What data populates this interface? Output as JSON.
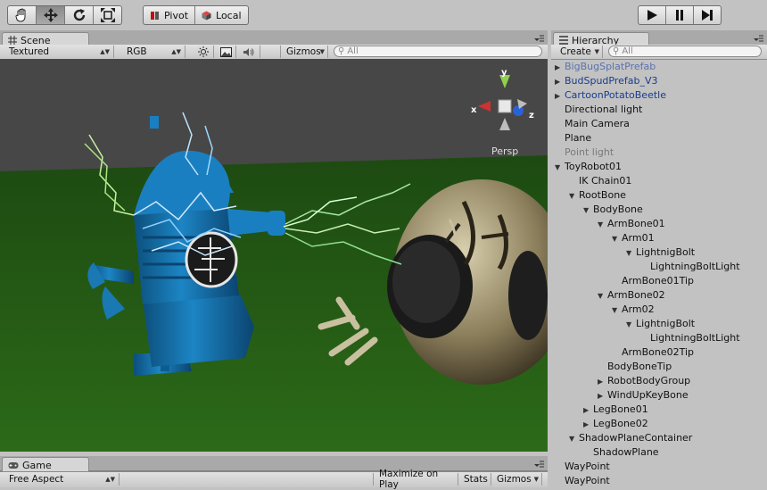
{
  "toolbar": {
    "tools": [
      {
        "icon": "hand-icon"
      },
      {
        "icon": "move-icon"
      },
      {
        "icon": "rotate-icon"
      },
      {
        "icon": "scale-icon"
      }
    ],
    "pivot_label": "Pivot",
    "local_label": "Local",
    "play_controls": [
      {
        "icon": "play-icon"
      },
      {
        "icon": "pause-icon"
      },
      {
        "icon": "step-icon"
      }
    ]
  },
  "scene": {
    "tab_label": "Scene",
    "render_mode": "Textured",
    "color_mode": "RGB",
    "gizmos_label": "Gizmos",
    "search_placeholder": "All",
    "projection_label": "Persp",
    "axis_x": "x",
    "axis_y": "y",
    "axis_z": "z"
  },
  "hierarchy": {
    "tab_label": "Hierarchy",
    "create_label": "Create",
    "search_placeholder": "All",
    "items": [
      {
        "label": "BigBugSplatPrefab",
        "depth": 0,
        "arrow": "collapsed",
        "style": "lightblue"
      },
      {
        "label": "BudSpudPrefab_V3",
        "depth": 0,
        "arrow": "collapsed",
        "style": "blue"
      },
      {
        "label": "CartoonPotatoBeetle",
        "depth": 0,
        "arrow": "collapsed",
        "style": "blue"
      },
      {
        "label": "Directional light",
        "depth": 0,
        "arrow": "none",
        "style": "normal"
      },
      {
        "label": "Main Camera",
        "depth": 0,
        "arrow": "none",
        "style": "normal"
      },
      {
        "label": "Plane",
        "depth": 0,
        "arrow": "none",
        "style": "normal"
      },
      {
        "label": "Point light",
        "depth": 0,
        "arrow": "none",
        "style": "grey"
      },
      {
        "label": "ToyRobot01",
        "depth": 0,
        "arrow": "expanded",
        "style": "normal"
      },
      {
        "label": "IK Chain01",
        "depth": 1,
        "arrow": "none",
        "style": "normal"
      },
      {
        "label": "RootBone",
        "depth": 1,
        "arrow": "expanded",
        "style": "normal"
      },
      {
        "label": "BodyBone",
        "depth": 2,
        "arrow": "expanded",
        "style": "normal"
      },
      {
        "label": "ArmBone01",
        "depth": 3,
        "arrow": "expanded",
        "style": "normal"
      },
      {
        "label": "Arm01",
        "depth": 4,
        "arrow": "expanded",
        "style": "normal"
      },
      {
        "label": "LightnigBolt",
        "depth": 5,
        "arrow": "expanded",
        "style": "normal"
      },
      {
        "label": "LightningBoltLight",
        "depth": 6,
        "arrow": "none",
        "style": "normal"
      },
      {
        "label": "ArmBone01Tip",
        "depth": 4,
        "arrow": "none",
        "style": "normal"
      },
      {
        "label": "ArmBone02",
        "depth": 3,
        "arrow": "expanded",
        "style": "normal"
      },
      {
        "label": "Arm02",
        "depth": 4,
        "arrow": "expanded",
        "style": "normal"
      },
      {
        "label": "LightnigBolt",
        "depth": 5,
        "arrow": "expanded",
        "style": "normal"
      },
      {
        "label": "LightningBoltLight",
        "depth": 6,
        "arrow": "none",
        "style": "normal"
      },
      {
        "label": "ArmBone02Tip",
        "depth": 4,
        "arrow": "none",
        "style": "normal"
      },
      {
        "label": "BodyBoneTip",
        "depth": 3,
        "arrow": "none",
        "style": "normal"
      },
      {
        "label": "RobotBodyGroup",
        "depth": 3,
        "arrow": "collapsed",
        "style": "normal"
      },
      {
        "label": "WindUpKeyBone",
        "depth": 3,
        "arrow": "collapsed",
        "style": "normal"
      },
      {
        "label": "LegBone01",
        "depth": 2,
        "arrow": "collapsed",
        "style": "normal"
      },
      {
        "label": "LegBone02",
        "depth": 2,
        "arrow": "collapsed",
        "style": "normal"
      },
      {
        "label": "ShadowPlaneContainer",
        "depth": 1,
        "arrow": "expanded",
        "style": "normal"
      },
      {
        "label": "ShadowPlane",
        "depth": 2,
        "arrow": "none",
        "style": "normal"
      },
      {
        "label": "WayPoint",
        "depth": 0,
        "arrow": "none",
        "style": "normal"
      },
      {
        "label": "WayPoint",
        "depth": 0,
        "arrow": "none",
        "style": "normal"
      }
    ]
  },
  "game": {
    "tab_label": "Game",
    "aspect_label": "Free Aspect",
    "maximize_label": "Maximize on Play",
    "stats_label": "Stats",
    "gizmos_label": "Gizmos"
  }
}
